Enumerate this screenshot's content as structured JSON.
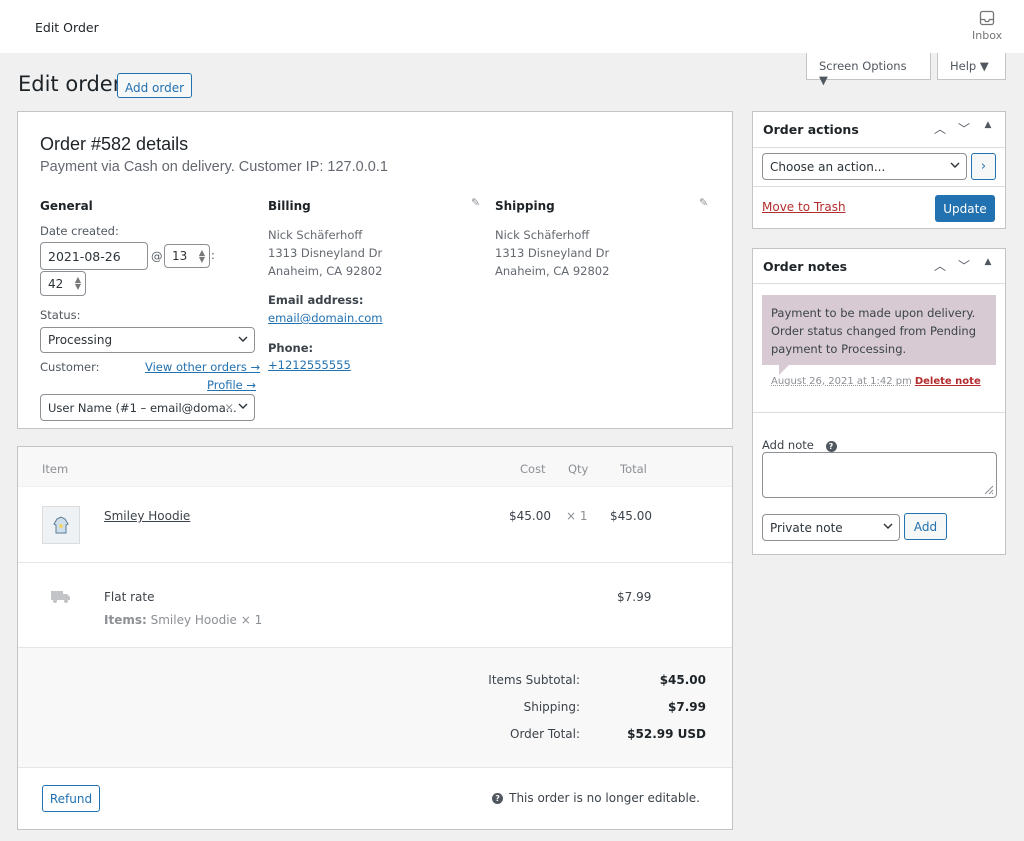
{
  "topbar": {
    "title": "Edit Order",
    "inbox_label": "Inbox"
  },
  "tabs": {
    "screen_options": "Screen Options ▼",
    "help": "Help ▼"
  },
  "page": {
    "heading": "Edit order",
    "add_order": "Add order"
  },
  "order": {
    "title": "Order #582 details",
    "subtitle": "Payment via Cash on delivery. Customer IP: 127.0.0.1",
    "general": {
      "heading": "General",
      "date_label": "Date created:",
      "date_value": "2021-08-26",
      "at": "@",
      "hour": "13",
      "colon": ":",
      "minute": "42",
      "status_label": "Status:",
      "status_value": "Processing",
      "customer_label": "Customer:",
      "view_other_orders": "View other orders →",
      "profile": "Profile →",
      "customer_value": "User Name (#1 – email@doma...",
      "clear": "×"
    },
    "billing": {
      "heading": "Billing",
      "name": "Nick Schäferhoff",
      "address1": "1313 Disneyland Dr",
      "address2": "Anaheim, CA 92802",
      "email_label": "Email address:",
      "email": "email@domain.com",
      "phone_label": "Phone:",
      "phone": "+1212555555"
    },
    "shipping": {
      "heading": "Shipping",
      "name": "Nick Schäferhoff",
      "address1": "1313 Disneyland Dr",
      "address2": "Anaheim, CA 92802"
    }
  },
  "items": {
    "headers": {
      "item": "Item",
      "cost": "Cost",
      "qty": "Qty",
      "total": "Total"
    },
    "line": {
      "name": "Smiley Hoodie",
      "cost": "$45.00",
      "qty": "× 1",
      "total": "$45.00"
    },
    "shipping": {
      "name": "Flat rate",
      "items_label": "Items:",
      "items_value": "Smiley Hoodie × 1",
      "total": "$7.99"
    },
    "totals": {
      "subtotal_label": "Items Subtotal:",
      "subtotal": "$45.00",
      "shipping_label": "Shipping:",
      "shipping": "$7.99",
      "order_total_label": "Order Total:",
      "order_total": "$52.99 USD"
    },
    "refund": "Refund",
    "not_editable": "This order is no longer editable."
  },
  "order_actions": {
    "title": "Order actions",
    "select_value": "Choose an action...",
    "go": "›",
    "trash": "Move to Trash",
    "update": "Update"
  },
  "order_notes": {
    "title": "Order notes",
    "note_text": "Payment to be made upon delivery. Order status changed from Pending payment to Processing.",
    "note_date": "August 26, 2021 at 1:42 pm",
    "delete": "Delete note",
    "add_note_label": "Add note",
    "note_type": "Private note",
    "add": "Add"
  },
  "colors": {
    "primary": "#2271b1",
    "danger": "#b32d2e",
    "note_bg": "#d7cad2"
  }
}
